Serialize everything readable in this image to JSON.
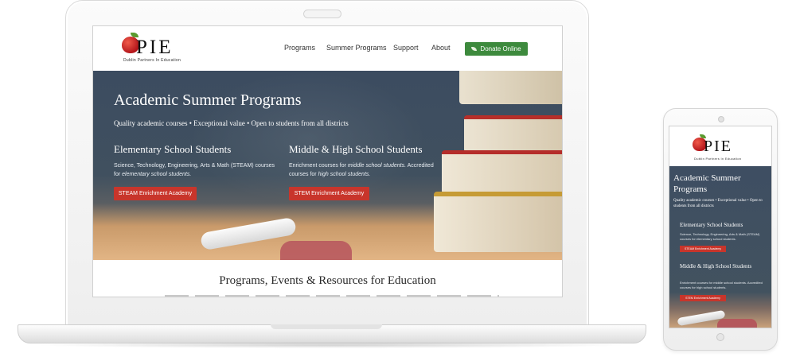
{
  "brand": {
    "name": "PIE",
    "tagline": "Dublin Partners In Education",
    "colors": {
      "accent_red": "#c8352b",
      "donate_green": "#3d8a3d",
      "hero_slate": "#3e4e62"
    }
  },
  "nav": {
    "items": [
      "Programs",
      "Summer Programs",
      "Support",
      "About"
    ],
    "donate_label": "Donate Online",
    "donate_icon": "leaf-icon"
  },
  "hero": {
    "title": "Academic Summer Programs",
    "subtitle": "Quality academic courses • Exceptional value • Open to students from all districts",
    "columns": [
      {
        "title": "Elementary School Students",
        "desc_pre": "Science, Technology, Engineering, Arts & Math (STEAM) courses for ",
        "desc_em": "elementary school students.",
        "desc_post": "",
        "button": "STEAM Enrichment Academy"
      },
      {
        "title": "Middle & High School Students",
        "desc_pre": "Enrichment courses for ",
        "desc_em": "middle school students.",
        "desc_post": " Accredited courses for ",
        "desc_em2": "high school students.",
        "button": "STEM Enrichment Academy"
      }
    ]
  },
  "section": {
    "title": "Programs, Events & Resources for Education"
  },
  "mobile": {
    "title": "Academic Summer Programs",
    "subtitle": "Quality academic courses • Exceptional value • Open to students from all districts",
    "columns": [
      {
        "title": "Elementary School Students",
        "desc": "Science, Technology, Engineering, Arts & Math (STEAM) courses for elementary school students.",
        "button": "STEAM Enrichment Academy"
      },
      {
        "title": "Middle & High School Students",
        "desc": "Enrichment courses for middle school students. Accredited courses for high school students.",
        "button": "STEM Enrichment Academy"
      }
    ]
  }
}
